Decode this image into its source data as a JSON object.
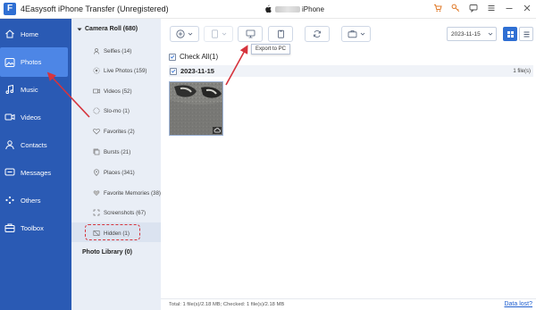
{
  "app": {
    "title": "4Easysoft iPhone Transfer (Unregistered)",
    "logo_letter": "F",
    "device_name": "iPhone"
  },
  "window_controls": [
    "cart-icon",
    "key-icon",
    "chat-icon",
    "menu-icon",
    "minimize-icon",
    "close-icon"
  ],
  "sidebar": {
    "items": [
      {
        "label": "Home",
        "icon": "home-icon",
        "active": false
      },
      {
        "label": "Photos",
        "icon": "photos-icon",
        "active": true
      },
      {
        "label": "Music",
        "icon": "music-icon",
        "active": false
      },
      {
        "label": "Videos",
        "icon": "video-icon",
        "active": false
      },
      {
        "label": "Contacts",
        "icon": "contacts-icon",
        "active": false
      },
      {
        "label": "Messages",
        "icon": "messages-icon",
        "active": false
      },
      {
        "label": "Others",
        "icon": "others-icon",
        "active": false
      },
      {
        "label": "Toolbox",
        "icon": "toolbox-icon",
        "active": false
      }
    ]
  },
  "categories": {
    "camera_roll": "Camera Roll (680)",
    "items": [
      {
        "label": "Selfies (14)",
        "icon": "selfie-icon"
      },
      {
        "label": "Live Photos (159)",
        "icon": "live-photo-icon"
      },
      {
        "label": "Videos (52)",
        "icon": "video-icon"
      },
      {
        "label": "Slo-mo (1)",
        "icon": "slomo-icon"
      },
      {
        "label": "Favorites (2)",
        "icon": "heart-icon"
      },
      {
        "label": "Bursts (21)",
        "icon": "bursts-icon"
      },
      {
        "label": "Places (341)",
        "icon": "place-icon"
      },
      {
        "label": "Favorite Memories (38)",
        "icon": "memories-icon"
      },
      {
        "label": "Screenshots (67)",
        "icon": "screenshot-icon"
      },
      {
        "label": "Hidden (1)",
        "icon": "hidden-icon"
      }
    ],
    "photo_library": "Photo Library (0)"
  },
  "toolbar": {
    "export_tooltip": "Export to PC",
    "date_value": "2023-11-15"
  },
  "content": {
    "check_all": "Check All(1)",
    "date_group": "2023-11-15",
    "file_count": "1 file(s)"
  },
  "status": {
    "text": "Total: 1 file(s)/2.18 MB; Checked: 1 file(s)/2.18 MB",
    "data_lost_link": "Data lost?"
  },
  "colors": {
    "sidebar_bg": "#2a5ab4",
    "sidebar_active": "#4d86e6",
    "panel_bg": "#e9eef6",
    "accent": "#2f6fd3",
    "annotation_red": "#d6343d"
  }
}
